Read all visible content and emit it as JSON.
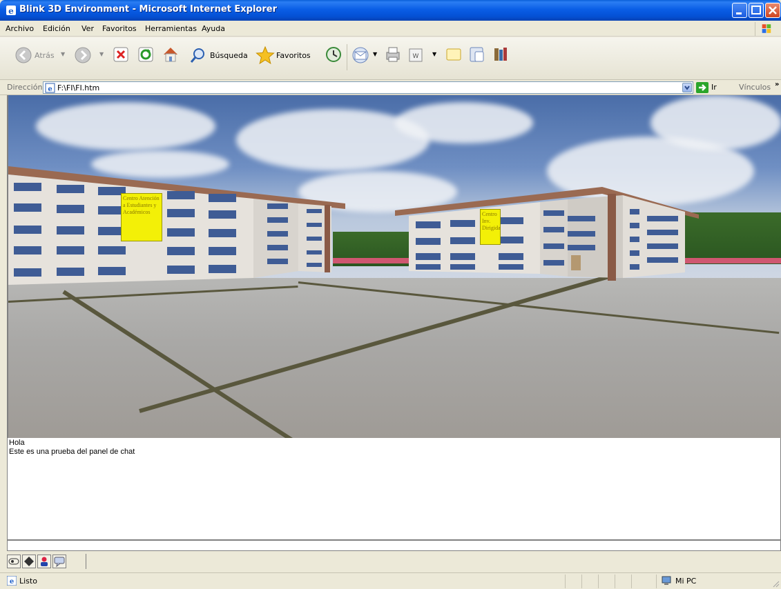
{
  "window": {
    "title": "Blink 3D Environment - Microsoft Internet Explorer"
  },
  "menu": {
    "items": [
      "Archivo",
      "Edición",
      "Ver",
      "Favoritos",
      "Herramientas",
      "Ayuda"
    ]
  },
  "toolbar": {
    "back_label": "Atrás",
    "search_label": "Búsqueda",
    "favorites_label": "Favoritos"
  },
  "address": {
    "label": "Dirección",
    "value": "F:\\FI\\FI.htm",
    "go_label": "Ir",
    "links_label": "Vínculos"
  },
  "scene": {
    "sign_left": "Centro Atención a Estudiantes y Académicos",
    "sign_right": "Centro Inv. Dirigida"
  },
  "chat": {
    "lines": [
      "Hola",
      "Este es una prueba del panel de chat"
    ]
  },
  "status": {
    "text": "Listo",
    "zone": "Mi PC"
  },
  "colors": {
    "titlebar": "#0a5ee6",
    "chrome": "#ece9d8",
    "sign": "#f3f007"
  }
}
